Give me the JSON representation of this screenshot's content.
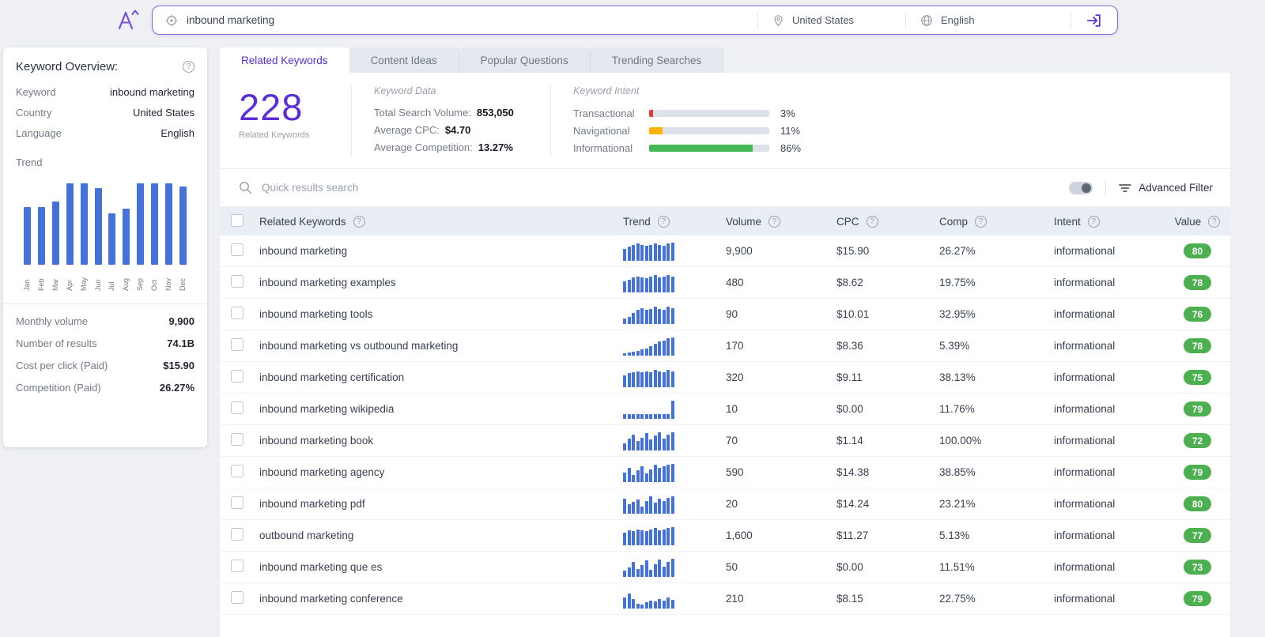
{
  "colors": {
    "accent": "#5b2ed8",
    "bar_blue": "#4472db",
    "badge_green": "#4caf50",
    "header_bg": "#e9edf4",
    "intent_transactional": "#e53935",
    "intent_navigational": "#ffb300",
    "intent_informational": "#43b854"
  },
  "icons": {
    "help": "?"
  },
  "topbar": {
    "search_value": "inbound marketing",
    "country": "United States",
    "language": "English"
  },
  "sidebar": {
    "title": "Keyword Overview:",
    "fields": [
      {
        "label": "Keyword",
        "value": "inbound marketing"
      },
      {
        "label": "Country",
        "value": "United States"
      },
      {
        "label": "Language",
        "value": "English"
      }
    ],
    "trend_label": "Trend",
    "trend_chart": {
      "type": "bar",
      "categories": [
        "Jan",
        "Feb",
        "Mar",
        "Apr",
        "May",
        "Jun",
        "Jul",
        "Aug",
        "Sep",
        "Oct",
        "Nov",
        "Dec"
      ],
      "values": [
        68,
        68,
        74,
        95,
        95,
        90,
        60,
        66,
        95,
        95,
        95,
        92
      ]
    },
    "stats": [
      {
        "label": "Monthly volume",
        "value": "9,900"
      },
      {
        "label": "Number of results",
        "value": "74.1B"
      },
      {
        "label": "Cost per click (Paid)",
        "value": "$15.90"
      },
      {
        "label": "Competition (Paid)",
        "value": "26.27%"
      }
    ]
  },
  "tabs": [
    {
      "label": "Related Keywords",
      "active": true
    },
    {
      "label": "Content Ideas",
      "active": false
    },
    {
      "label": "Popular Questions",
      "active": false
    },
    {
      "label": "Trending Searches",
      "active": false
    }
  ],
  "summary": {
    "count": "228",
    "count_label": "Related Keywords",
    "keyword_data": {
      "title": "Keyword Data",
      "rows": [
        {
          "label": "Total Search Volume:",
          "value": "853,050"
        },
        {
          "label": "Average CPC:",
          "value": "$4.70"
        },
        {
          "label": "Average Competition:",
          "value": "13.27%"
        }
      ]
    },
    "keyword_intent": {
      "title": "Keyword Intent",
      "rows": [
        {
          "label": "Transactional",
          "pct": "3%",
          "value": 3,
          "color": "#e53935"
        },
        {
          "label": "Navigational",
          "pct": "11%",
          "value": 11,
          "color": "#ffb300"
        },
        {
          "label": "Informational",
          "pct": "86%",
          "value": 86,
          "color": "#43b854"
        }
      ]
    }
  },
  "filter_bar": {
    "search_placeholder": "Quick results search",
    "advanced_filter_label": "Advanced Filter"
  },
  "table": {
    "columns": [
      "Related Keywords",
      "Trend",
      "Volume",
      "CPC",
      "Comp",
      "Intent",
      "Value"
    ],
    "rows": [
      {
        "keyword": "inbound marketing",
        "trend": [
          55,
          65,
          75,
          80,
          75,
          70,
          75,
          80,
          75,
          70,
          80,
          85
        ],
        "volume": "9,900",
        "cpc": "$15.90",
        "comp": "26.27%",
        "intent": "informational",
        "value": "80"
      },
      {
        "keyword": "inbound marketing examples",
        "trend": [
          50,
          60,
          70,
          75,
          70,
          65,
          75,
          80,
          70,
          75,
          80,
          75
        ],
        "volume": "480",
        "cpc": "$8.62",
        "comp": "19.75%",
        "intent": "informational",
        "value": "78"
      },
      {
        "keyword": "inbound marketing tools",
        "trend": [
          25,
          35,
          50,
          65,
          75,
          65,
          70,
          80,
          70,
          65,
          80,
          75
        ],
        "volume": "90",
        "cpc": "$10.01",
        "comp": "32.95%",
        "intent": "informational",
        "value": "76"
      },
      {
        "keyword": "inbound marketing vs outbound marketing",
        "trend": [
          12,
          15,
          18,
          22,
          28,
          35,
          45,
          55,
          65,
          72,
          80,
          85
        ],
        "volume": "170",
        "cpc": "$8.36",
        "comp": "5.39%",
        "intent": "informational",
        "value": "78"
      },
      {
        "keyword": "inbound marketing certification",
        "trend": [
          55,
          65,
          70,
          75,
          70,
          75,
          70,
          80,
          75,
          70,
          80,
          75
        ],
        "volume": "320",
        "cpc": "$9.11",
        "comp": "38.13%",
        "intent": "informational",
        "value": "75"
      },
      {
        "keyword": "inbound marketing wikipedia",
        "trend": [
          22,
          22,
          22,
          22,
          22,
          22,
          22,
          22,
          22,
          22,
          22,
          85
        ],
        "volume": "10",
        "cpc": "$0.00",
        "comp": "11.76%",
        "intent": "informational",
        "value": "79"
      },
      {
        "keyword": "inbound marketing book",
        "trend": [
          35,
          55,
          75,
          45,
          60,
          80,
          50,
          70,
          85,
          55,
          75,
          85
        ],
        "volume": "70",
        "cpc": "$1.14",
        "comp": "100.00%",
        "intent": "informational",
        "value": "72"
      },
      {
        "keyword": "inbound marketing agency",
        "trend": [
          45,
          65,
          35,
          55,
          75,
          40,
          60,
          80,
          65,
          75,
          80,
          85
        ],
        "volume": "590",
        "cpc": "$14.38",
        "comp": "38.85%",
        "intent": "informational",
        "value": "79"
      },
      {
        "keyword": "inbound marketing pdf",
        "trend": [
          70,
          45,
          55,
          65,
          35,
          60,
          80,
          50,
          70,
          60,
          75,
          80
        ],
        "volume": "20",
        "cpc": "$14.24",
        "comp": "23.21%",
        "intent": "informational",
        "value": "80"
      },
      {
        "keyword": "outbound marketing",
        "trend": [
          60,
          70,
          65,
          75,
          70,
          65,
          75,
          80,
          70,
          75,
          80,
          85
        ],
        "volume": "1,600",
        "cpc": "$11.27",
        "comp": "5.13%",
        "intent": "informational",
        "value": "77"
      },
      {
        "keyword": "inbound marketing que es",
        "trend": [
          28,
          45,
          70,
          38,
          55,
          78,
          32,
          60,
          82,
          48,
          70,
          85
        ],
        "volume": "50",
        "cpc": "$0.00",
        "comp": "11.51%",
        "intent": "informational",
        "value": "73"
      },
      {
        "keyword": "inbound marketing conference",
        "trend": [
          50,
          70,
          45,
          22,
          18,
          28,
          38,
          32,
          45,
          38,
          50,
          42
        ],
        "volume": "210",
        "cpc": "$8.15",
        "comp": "22.75%",
        "intent": "informational",
        "value": "79"
      }
    ]
  }
}
